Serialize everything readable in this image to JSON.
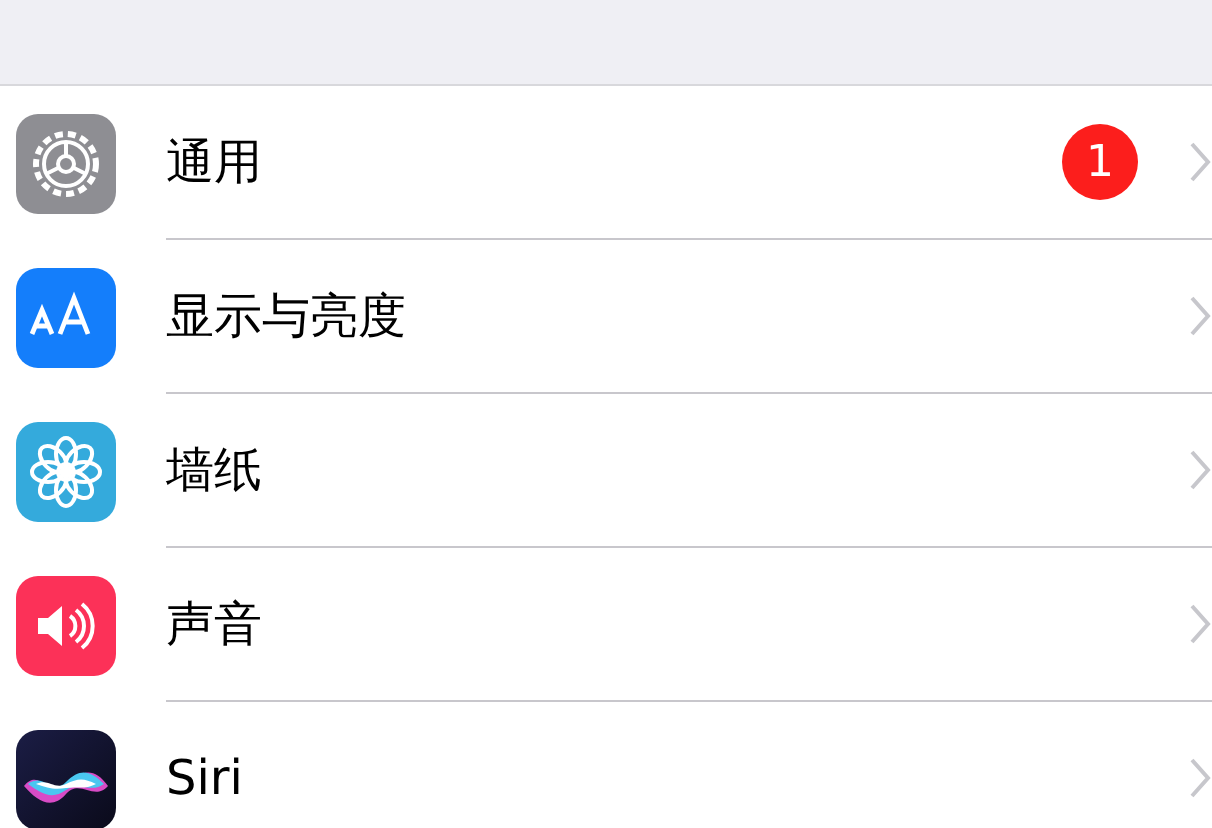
{
  "settings": [
    {
      "label": "通用",
      "kind": "general",
      "badge": "1"
    },
    {
      "label": "显示与亮度",
      "kind": "display"
    },
    {
      "label": "墙纸",
      "kind": "wallpaper"
    },
    {
      "label": "声音",
      "kind": "sound"
    },
    {
      "label": "Siri",
      "kind": "siri"
    }
  ]
}
